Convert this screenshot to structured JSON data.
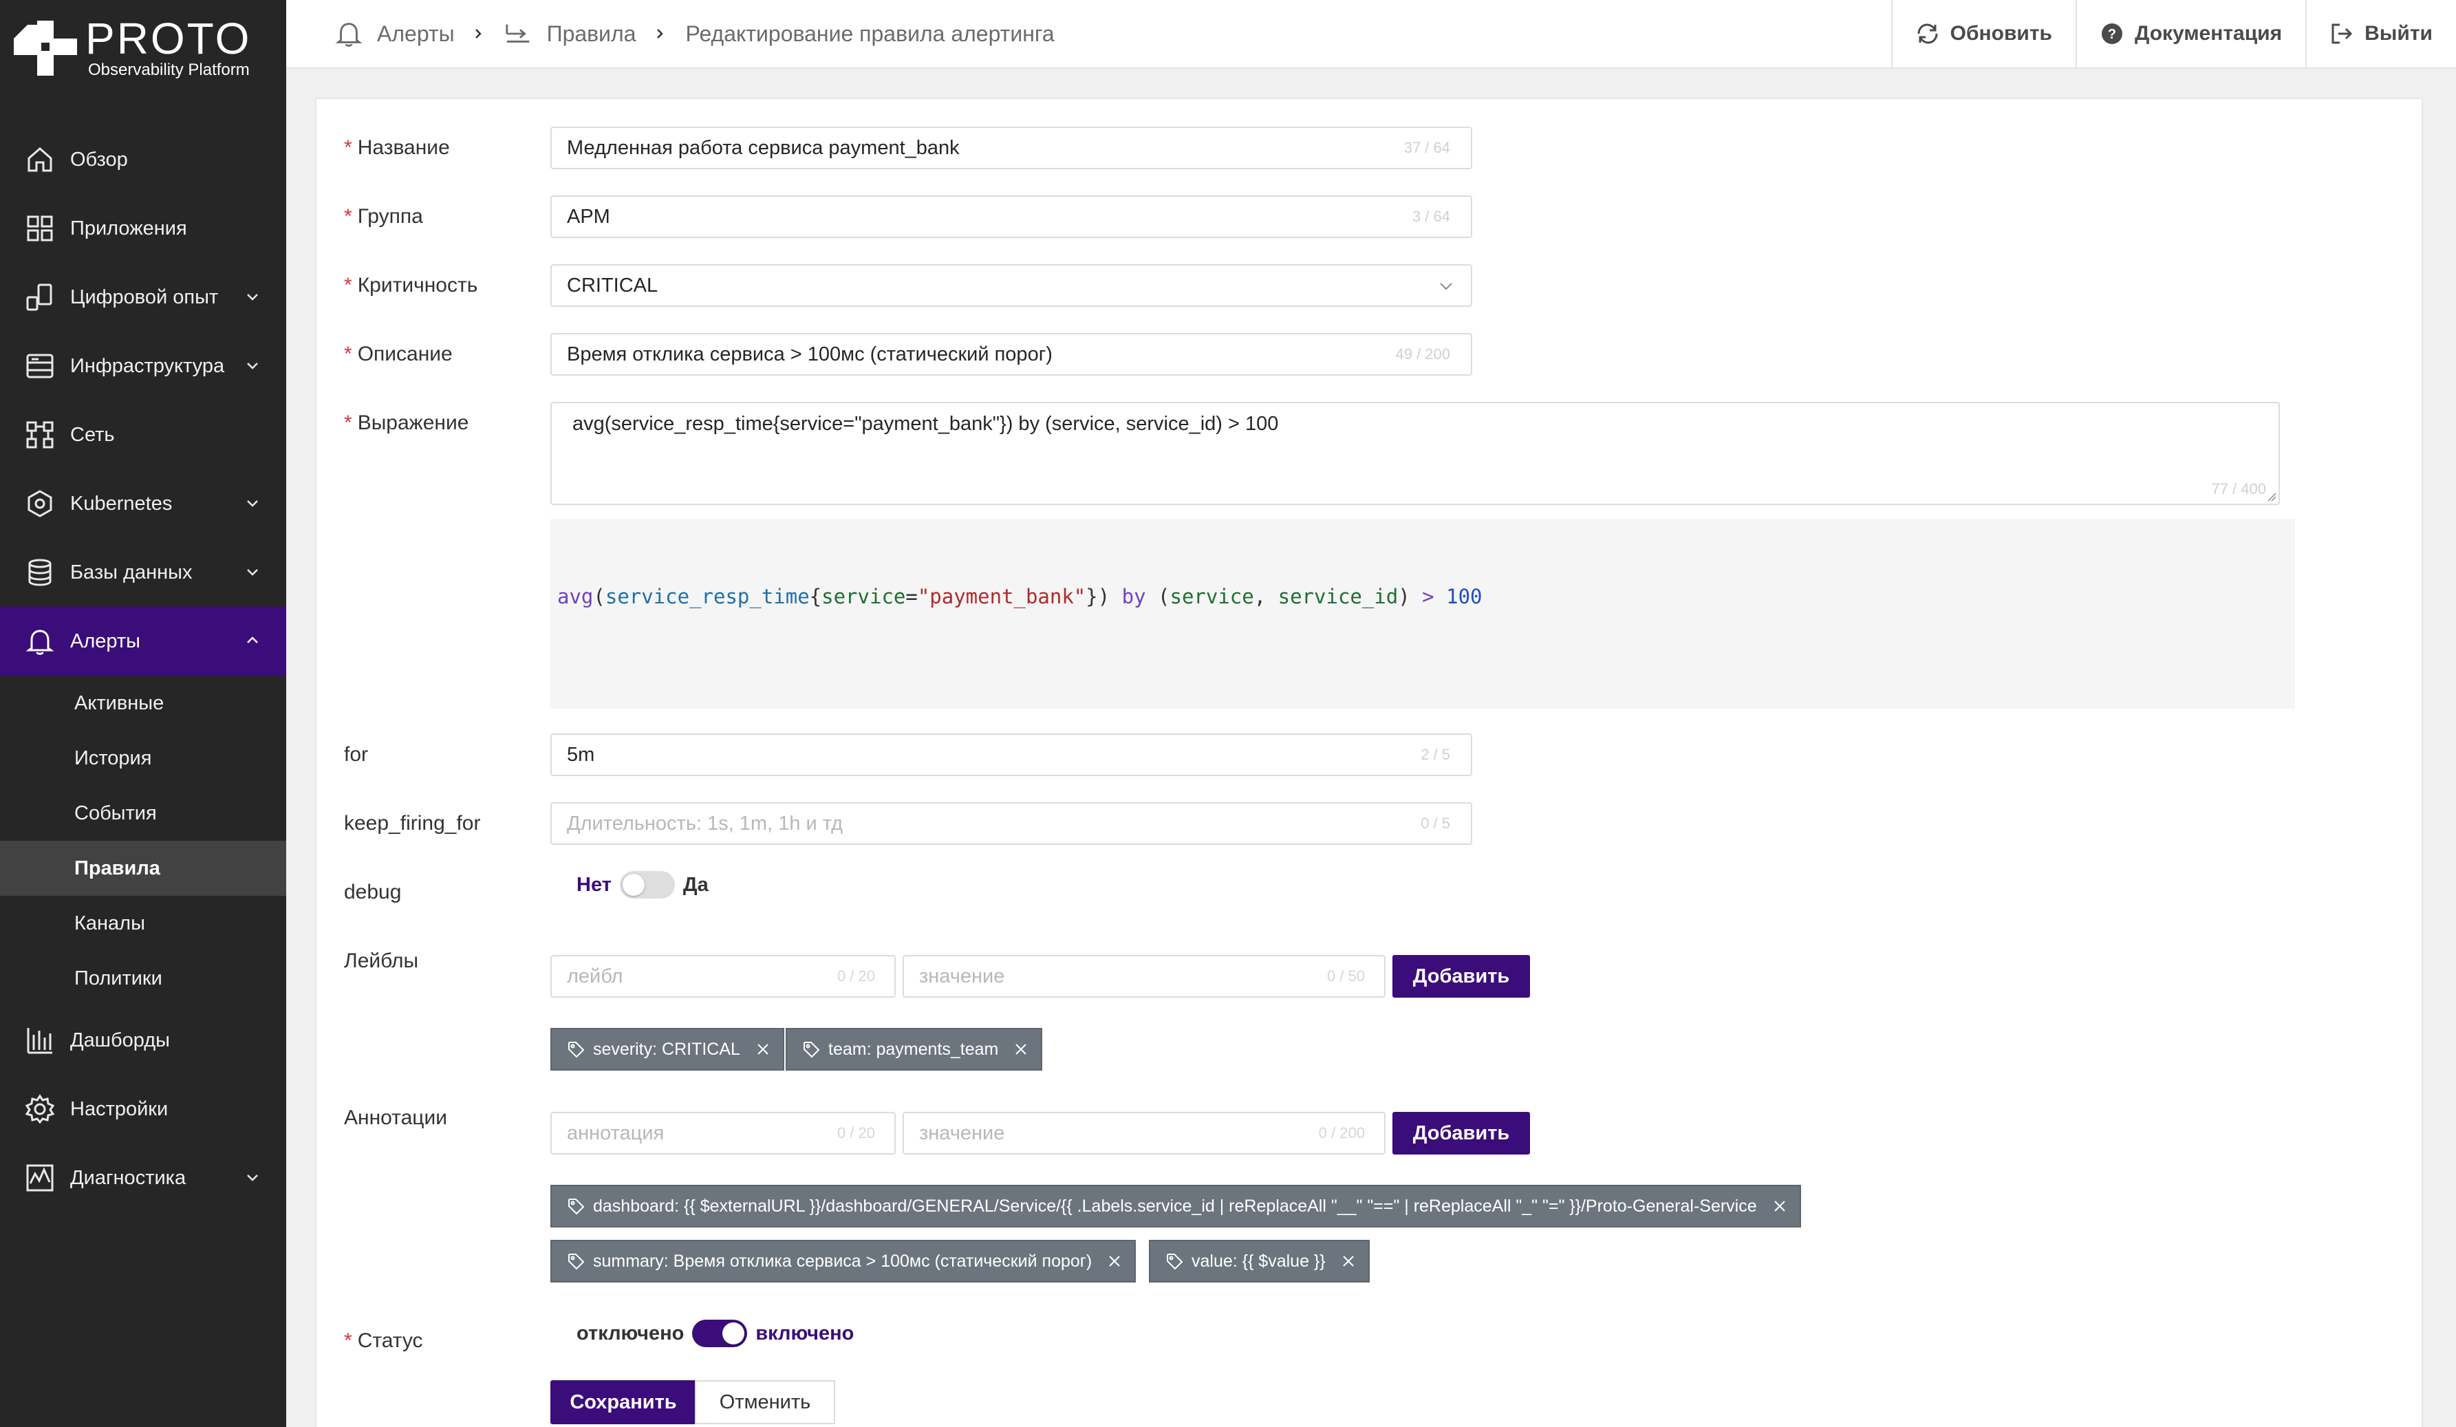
{
  "app": {
    "logo_title": "PROTO",
    "logo_subtitle": "Observability Platform"
  },
  "sidebar": {
    "items": [
      {
        "label": "Обзор",
        "icon": "home-icon"
      },
      {
        "label": "Приложения",
        "icon": "apps-grid-icon"
      },
      {
        "label": "Цифровой опыт",
        "icon": "digital-experience-icon",
        "expandable": true
      },
      {
        "label": "Инфраструктура",
        "icon": "server-icon",
        "expandable": true
      },
      {
        "label": "Сеть",
        "icon": "network-icon"
      },
      {
        "label": "Kubernetes",
        "icon": "kubernetes-icon",
        "expandable": true
      },
      {
        "label": "Базы данных",
        "icon": "database-icon",
        "expandable": true
      },
      {
        "label": "Алерты",
        "icon": "bell-icon",
        "expandable": true,
        "expanded": true
      },
      {
        "label": "Дашборды",
        "icon": "bar-chart-icon"
      },
      {
        "label": "Настройки",
        "icon": "gear-icon"
      },
      {
        "label": "Диагностика",
        "icon": "diagnostics-icon",
        "expandable": true
      }
    ],
    "alert_subitems": [
      "Активные",
      "История",
      "События",
      "Правила",
      "Каналы",
      "Политики"
    ],
    "active_subitem": "Правила"
  },
  "header": {
    "breadcrumbs": [
      "Алерты",
      "Правила",
      "Редактирование правила алертинга"
    ],
    "actions": {
      "refresh": "Обновить",
      "docs": "Документация",
      "logout": "Выйти"
    }
  },
  "form": {
    "name": {
      "label": "Название",
      "value": "Медленная работа сервиса payment_bank",
      "count": "37 / 64"
    },
    "group": {
      "label": "Группа",
      "value": "APM",
      "count": "3 / 64"
    },
    "severity": {
      "label": "Критичность",
      "value": "CRITICAL"
    },
    "description": {
      "label": "Описание",
      "value": "Время отклика сервиса > 100мс (статический порог)",
      "count": "49 / 200"
    },
    "expression": {
      "label": "Выражение",
      "value": "avg(service_resp_time{service=\"payment_bank\"}) by (service, service_id) > 100",
      "count": "77 / 400",
      "highlight": {
        "fn": "avg",
        "metric": "service_resp_time",
        "label_key": "service",
        "label_value": "\"payment_bank\"",
        "by": "by",
        "group1": "service",
        "group2": "service_id",
        "op": ">",
        "threshold": "100"
      }
    },
    "for": {
      "label": "for",
      "value": "5m",
      "count": "2 / 5"
    },
    "keep_firing_for": {
      "label": "keep_firing_for",
      "placeholder": "Длительность: 1s, 1m, 1h и тд",
      "count": "0 / 5"
    },
    "debug": {
      "label": "debug",
      "off_label": "Нет",
      "on_label": "Да",
      "enabled": false
    },
    "labels": {
      "label": "Лейблы",
      "key_placeholder": "лейбл",
      "key_count": "0 / 20",
      "value_placeholder": "значение",
      "value_count": "0 / 50",
      "add_button": "Добавить",
      "tags": [
        "severity: CRITICAL",
        "team: payments_team"
      ]
    },
    "annotations": {
      "label": "Аннотации",
      "key_placeholder": "аннотация",
      "key_count": "0 / 20",
      "value_placeholder": "значение",
      "value_count": "0 / 200",
      "add_button": "Добавить",
      "tags": [
        "dashboard: {{ $externalURL }}/dashboard/GENERAL/Service/{{ .Labels.service_id | reReplaceAll \"__\" \"==\" | reReplaceAll \"_\" \"=\" }}/Proto-General-Service",
        "summary: Время отклика сервиса > 100мс (статический порог)",
        "value: {{ $value }}"
      ]
    },
    "status": {
      "label": "Статус",
      "off_label": "отключено",
      "on_label": "включено",
      "enabled": true
    },
    "save_button": "Сохранить",
    "cancel_button": "Отменить"
  },
  "colors": {
    "sidebar_bg": "#262626",
    "accent": "#3b0d7a",
    "tag_bg": "#6c757d",
    "required": "#d9363e"
  }
}
